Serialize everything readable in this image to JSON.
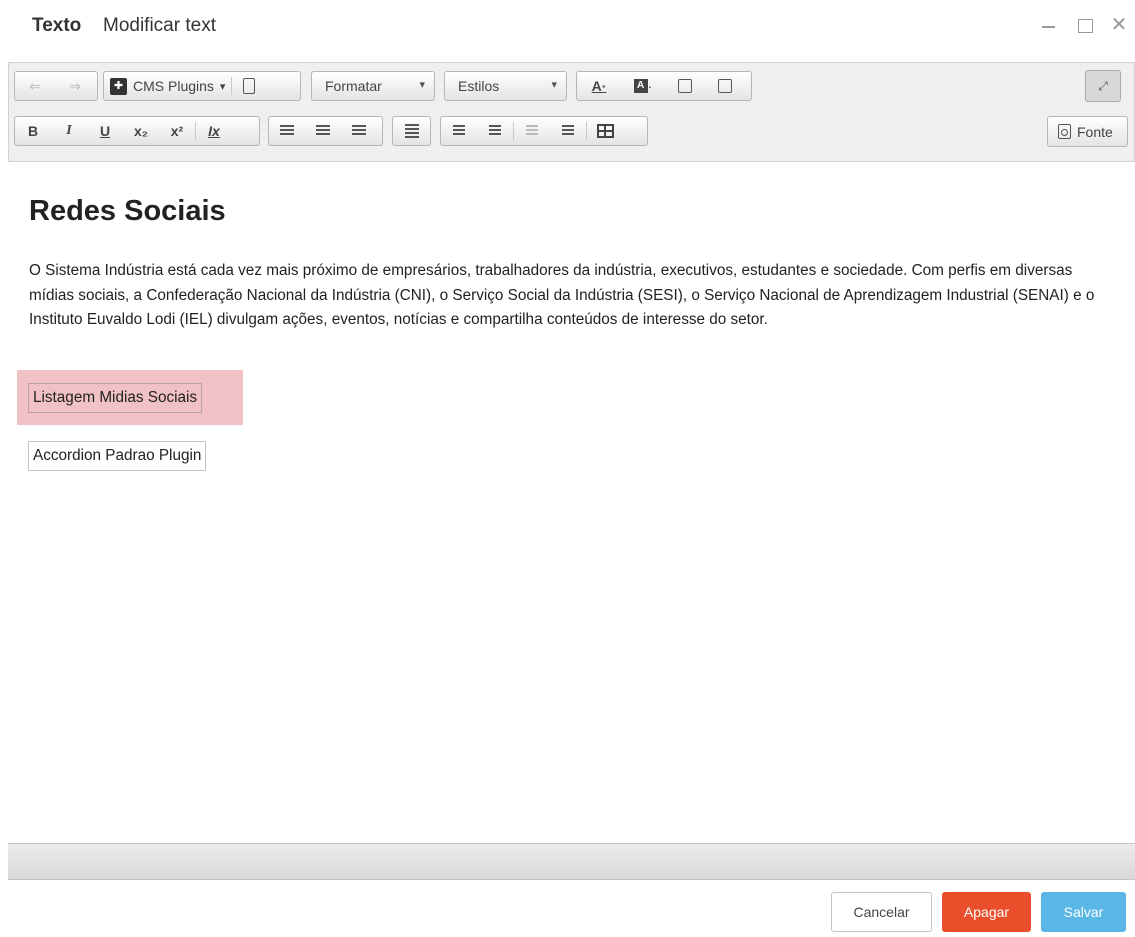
{
  "window": {
    "title": "Texto",
    "subtitle": "Modificar text"
  },
  "toolbar": {
    "cms_plugins_label": "CMS Plugins",
    "format_label": "Formatar",
    "styles_label": "Estilos",
    "source_label": "Fonte",
    "bold": "B",
    "italic": "I",
    "underline": "U",
    "subscript": "x₂",
    "superscript": "x²",
    "remove_format": "Ix"
  },
  "editor": {
    "heading": "Redes Sociais",
    "paragraph": "O Sistema Indústria está cada vez mais próximo de empresários, trabalhadores da indústria, executivos, estudantes e sociedade. Com perfis em diversas mídias sociais, a Confederação Nacional da Indústria (CNI), o Serviço Social da Indústria (SESI), o Serviço Nacional de Aprendizagem Industrial (SENAI) e o Instituto Euvaldo Lodi (IEL) divulgam ações, eventos, notícias e compartilha conteúdos de interesse do setor.",
    "plugins": [
      {
        "label": "Listagem Midias Sociais",
        "selected": true
      },
      {
        "label": "Accordion Padrao Plugin",
        "selected": false
      }
    ]
  },
  "footer": {
    "cancel_label": "Cancelar",
    "delete_label": "Apagar",
    "save_label": "Salvar"
  },
  "colors": {
    "delete_button": "#ea4f2b",
    "save_button": "#5ab7e5",
    "plugin_highlight": "#f0c1c5"
  }
}
